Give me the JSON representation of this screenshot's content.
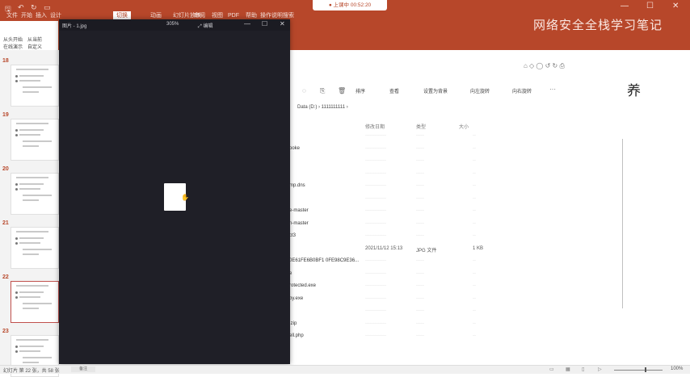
{
  "ppt": {
    "tabs": [
      "文件",
      "开始",
      "插入",
      "设计",
      "切换",
      "动画",
      "幻灯片放映",
      "审阅",
      "视图",
      "PDF",
      "帮助",
      "操作说明搜索"
    ],
    "active_tab_index": 4,
    "recording_text": "● 上课中 00:52:20",
    "doc_title": "网络安全全栈学习笔记",
    "ribbon_labels": [
      "从头开始",
      "从当前",
      "在线演示",
      "自定义"
    ],
    "accent": "#b7472a"
  },
  "slides": [
    {
      "num": "18"
    },
    {
      "num": "19"
    },
    {
      "num": "20"
    },
    {
      "num": "21"
    },
    {
      "num": "22"
    },
    {
      "num": "23"
    }
  ],
  "selected_slide_index": 4,
  "viewer": {
    "title": "图片 - 1.jpg",
    "zoom": "305%",
    "edit_label": "编辑",
    "background": "#1f1f27"
  },
  "explorer": {
    "toolbar": [
      "排序",
      "查看",
      "设置为背景",
      "向左旋转",
      "向右旋转"
    ],
    "breadcrumb": "Data (D:) › 1111111111 ›",
    "headers": {
      "date": "修改日期",
      "type": "类型",
      "size": "大小"
    },
    "rows": [
      {
        "name": "",
        "date": "",
        "type": "",
        "size": ""
      },
      {
        "name": "ooke",
        "date": "",
        "type": "",
        "size": ""
      },
      {
        "name": "",
        "date": "",
        "type": "",
        "size": ""
      },
      {
        "name": "",
        "date": "",
        "type": "",
        "size": ""
      },
      {
        "name": "mp.dns",
        "date": "",
        "type": "",
        "size": ""
      },
      {
        "name": "",
        "date": "",
        "type": "",
        "size": ""
      },
      {
        "name": "e-master",
        "date": "",
        "type": "",
        "size": ""
      },
      {
        "name": "n-master",
        "date": "",
        "type": "",
        "size": ""
      },
      {
        "name": "ct3",
        "date": "",
        "type": "",
        "size": ""
      },
      {
        "name": "",
        "date": "2021/11/12 15:13",
        "type": "JPG 文件",
        "size": "1 KB"
      },
      {
        "name": "0E61FE6B0BF1 0FE98C9E36...",
        "date": "",
        "type": "",
        "size": ""
      },
      {
        "name": "e",
        "date": "",
        "type": "",
        "size": ""
      },
      {
        "name": "rotected.exe",
        "date": "",
        "type": "",
        "size": ""
      },
      {
        "name": "by.exe",
        "date": "",
        "type": "",
        "size": ""
      },
      {
        "name": "",
        "date": "",
        "type": "",
        "size": ""
      },
      {
        "name": ".zip",
        "date": "",
        "type": "",
        "size": ""
      },
      {
        "name": "ell.php",
        "date": "",
        "type": "",
        "size": ""
      }
    ],
    "side_text": "养"
  },
  "status": {
    "left": "幻灯片 第 22 张，共 58 张",
    "notes": "备注",
    "zoom": "100%"
  }
}
